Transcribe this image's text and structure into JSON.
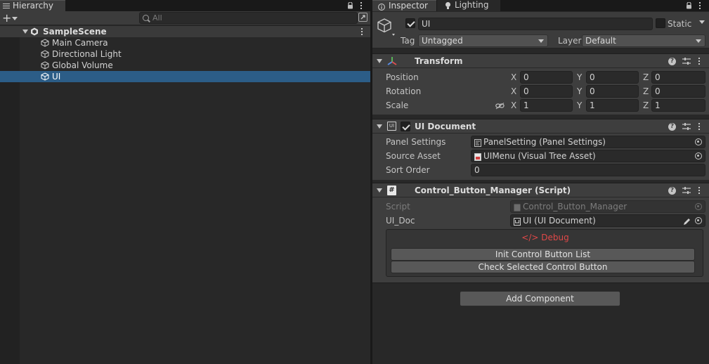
{
  "hierarchy": {
    "tab_label": "Hierarchy",
    "search_placeholder": "All",
    "scene_name": "SampleScene",
    "items": [
      {
        "label": "Main Camera",
        "selected": false
      },
      {
        "label": "Directional Light",
        "selected": false
      },
      {
        "label": "Global Volume",
        "selected": false
      },
      {
        "label": "UI",
        "selected": true
      }
    ]
  },
  "inspector": {
    "tabs": [
      {
        "label": "Inspector",
        "active": true
      },
      {
        "label": "Lighting",
        "active": false
      }
    ],
    "object_name": "UI",
    "static_label": "Static",
    "tag_label": "Tag",
    "tag_value": "Untagged",
    "layer_label": "Layer",
    "layer_value": "Default"
  },
  "transform": {
    "title": "Transform",
    "rows": [
      {
        "label": "Position",
        "x": "0",
        "y": "0",
        "z": "0"
      },
      {
        "label": "Rotation",
        "x": "0",
        "y": "0",
        "z": "0"
      },
      {
        "label": "Scale",
        "x": "1",
        "y": "1",
        "z": "1"
      }
    ],
    "axis": {
      "x": "X",
      "y": "Y",
      "z": "Z"
    }
  },
  "ui_document": {
    "title": "UI Document",
    "icon_text": "UI",
    "panel_settings_label": "Panel Settings",
    "panel_settings_value": "PanelSetting (Panel Settings)",
    "source_asset_label": "Source Asset",
    "source_asset_value": "UIMenu (Visual Tree Asset)",
    "sort_order_label": "Sort Order",
    "sort_order_value": "0"
  },
  "script_component": {
    "title": "Control_Button_Manager (Script)",
    "icon_text": "#",
    "script_label": "Script",
    "script_value": "Control_Button_Manager",
    "ui_doc_label": "UI_Doc",
    "ui_doc_value": "UI (UI Document)",
    "debug_title": "Debug",
    "debug_icon": "</>",
    "buttons": [
      "Init Control Button List",
      "Check Selected Control Button"
    ]
  },
  "add_component_label": "Add Component",
  "colors": {
    "selection": "#2c5d87",
    "debug": "#e04848",
    "panel": "#282828",
    "header": "#3c3c3c"
  }
}
